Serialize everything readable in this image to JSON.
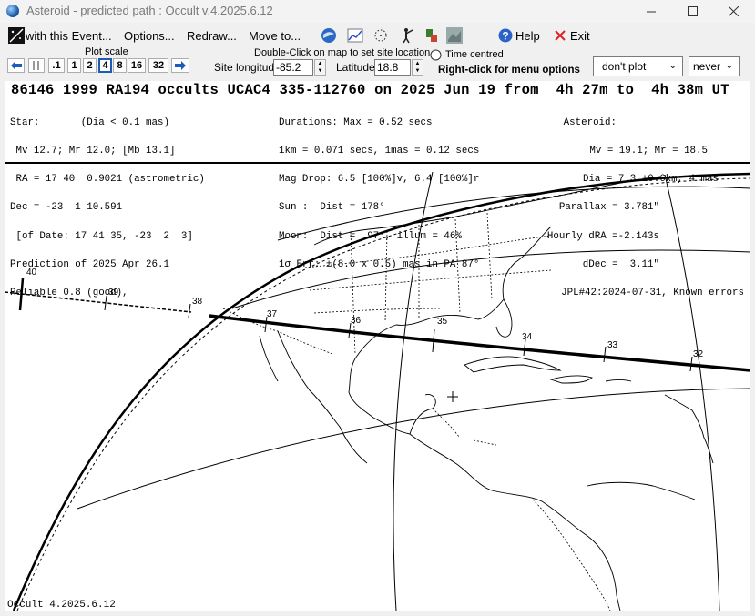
{
  "window": {
    "title": "Asteroid - predicted path : Occult v.4.2025.6.12"
  },
  "menu": {
    "with_event": "with this Event...",
    "options": "Options...",
    "redraw": "Redraw...",
    "move_to": "Move to...",
    "help": "Help",
    "exit": "Exit"
  },
  "toolbar": {
    "plot_scale_label": "Plot scale",
    "scale_buttons": [
      ".1",
      "1",
      "2",
      "4",
      "8",
      "16",
      "32"
    ],
    "double_click_hint": "Double-Click on map to set site location",
    "time_centred_label": "Time centred",
    "site_longitude_label": "Site longitude",
    "site_longitude_value": "-85.2",
    "latitude_label": "Latitude",
    "latitude_value": "18.8",
    "right_click_hint": "Right-click for menu options",
    "plot_select_value": "don't plot",
    "never_select_value": "never"
  },
  "event": {
    "headline": "86146 1999 RA194 occults UCAC4 335-112760 on 2025 Jun 19 from  4h 27m to  4h 38m UT",
    "col1": [
      "Star:       (Dia < 0.1 mas)",
      " Mv 12.7; Mr 12.0; [Mb 13.1]",
      " RA = 17 40  0.9021 (astrometric)",
      "Dec = -23  1 10.591",
      " [of Date: 17 41 35, -23  2  3]",
      "Prediction of 2025 Apr 26.1",
      "Reliable 0.8 (good),"
    ],
    "col2": [
      "Durations: Max = 0.52 secs",
      "1km = 0.071 secs, 1mas = 0.12 secs",
      "Mag Drop: 6.5 [100%]v, 6.4 [100%]r",
      "Sun :  Dist = 178°",
      "Moon:  Dist =  97°, illum = 46%",
      "1σ Err: ±(8.0 x 0.5) mas in PA 87°"
    ],
    "col3": [
      "Asteroid:",
      "Mv = 19.1; Mr = 18.5",
      "Dia = 7.3 ±0.6km, 4 mas",
      "Parallax = 3.781\"",
      "Hourly dRA =-2.143s",
      "dDec =  3.11\"",
      "JPL#42:2024-07-31, Known errors"
    ]
  },
  "map": {
    "time_labels": [
      "40",
      "39",
      "38",
      "37",
      "36",
      "35",
      "34",
      "33",
      "32"
    ]
  },
  "footer": {
    "version": "Occult 4.2025.6.12"
  }
}
